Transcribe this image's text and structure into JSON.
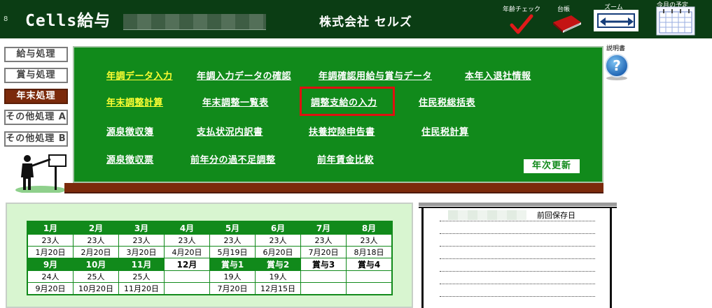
{
  "header": {
    "row_number": "8",
    "app_title": "Cells給与",
    "company_name": "株式会社 セルズ",
    "age_check_label": "年齢チェック",
    "ledger_label": "台帳",
    "zoom_label": "ズーム",
    "schedule_label": "今月の予定"
  },
  "nav": {
    "items": [
      "給与処理",
      "賞与処理",
      "年末処理",
      "その他処理 A",
      "その他処理 B"
    ],
    "active": "年末処理"
  },
  "board": {
    "row1": [
      "年調データ入力",
      "年調入力データの確認",
      "年調確認用給与賞与データ",
      "本年入退社情報"
    ],
    "row2": [
      "年末調整計算",
      "年末調整一覧表",
      "調整支給の入力",
      "住民税総括表"
    ],
    "row3": [
      "源泉徴収簿",
      "支払状況内訳書",
      "扶養控除申告書",
      "住民税計算"
    ],
    "row4": [
      "源泉徴収票",
      "前年分の過不足調整",
      "前年賃金比較"
    ],
    "annual_update": "年次更新",
    "manual_label": "説明書"
  },
  "months": {
    "row1_headers": [
      "1月",
      "2月",
      "3月",
      "4月",
      "5月",
      "6月",
      "7月",
      "8月"
    ],
    "row1_counts": [
      "23人",
      "23人",
      "23人",
      "23人",
      "23人",
      "23人",
      "23人",
      "23人"
    ],
    "row1_dates": [
      "1月20日",
      "2月20日",
      "3月20日",
      "4月20日",
      "5月19日",
      "6月20日",
      "7月20日",
      "8月18日"
    ],
    "row2_headers": [
      "9月",
      "10月",
      "11月",
      "12月",
      "賞与1",
      "賞与2",
      "賞与3",
      "賞与4"
    ],
    "row2_counts": [
      "24人",
      "25人",
      "25人",
      "",
      "19人",
      "19人",
      "",
      ""
    ],
    "row2_dates": [
      "9月20日",
      "10月20日",
      "11月20日",
      "",
      "7月20日",
      "12月15日",
      "",
      ""
    ]
  },
  "save_panel": {
    "last_saved_label": "前回保存日"
  },
  "colors": {
    "topbar": "#0b3d14",
    "board": "#118a1b",
    "ledge": "#7b2a0b",
    "highlight": "#e01010",
    "link_highlight": "#ffff33"
  }
}
